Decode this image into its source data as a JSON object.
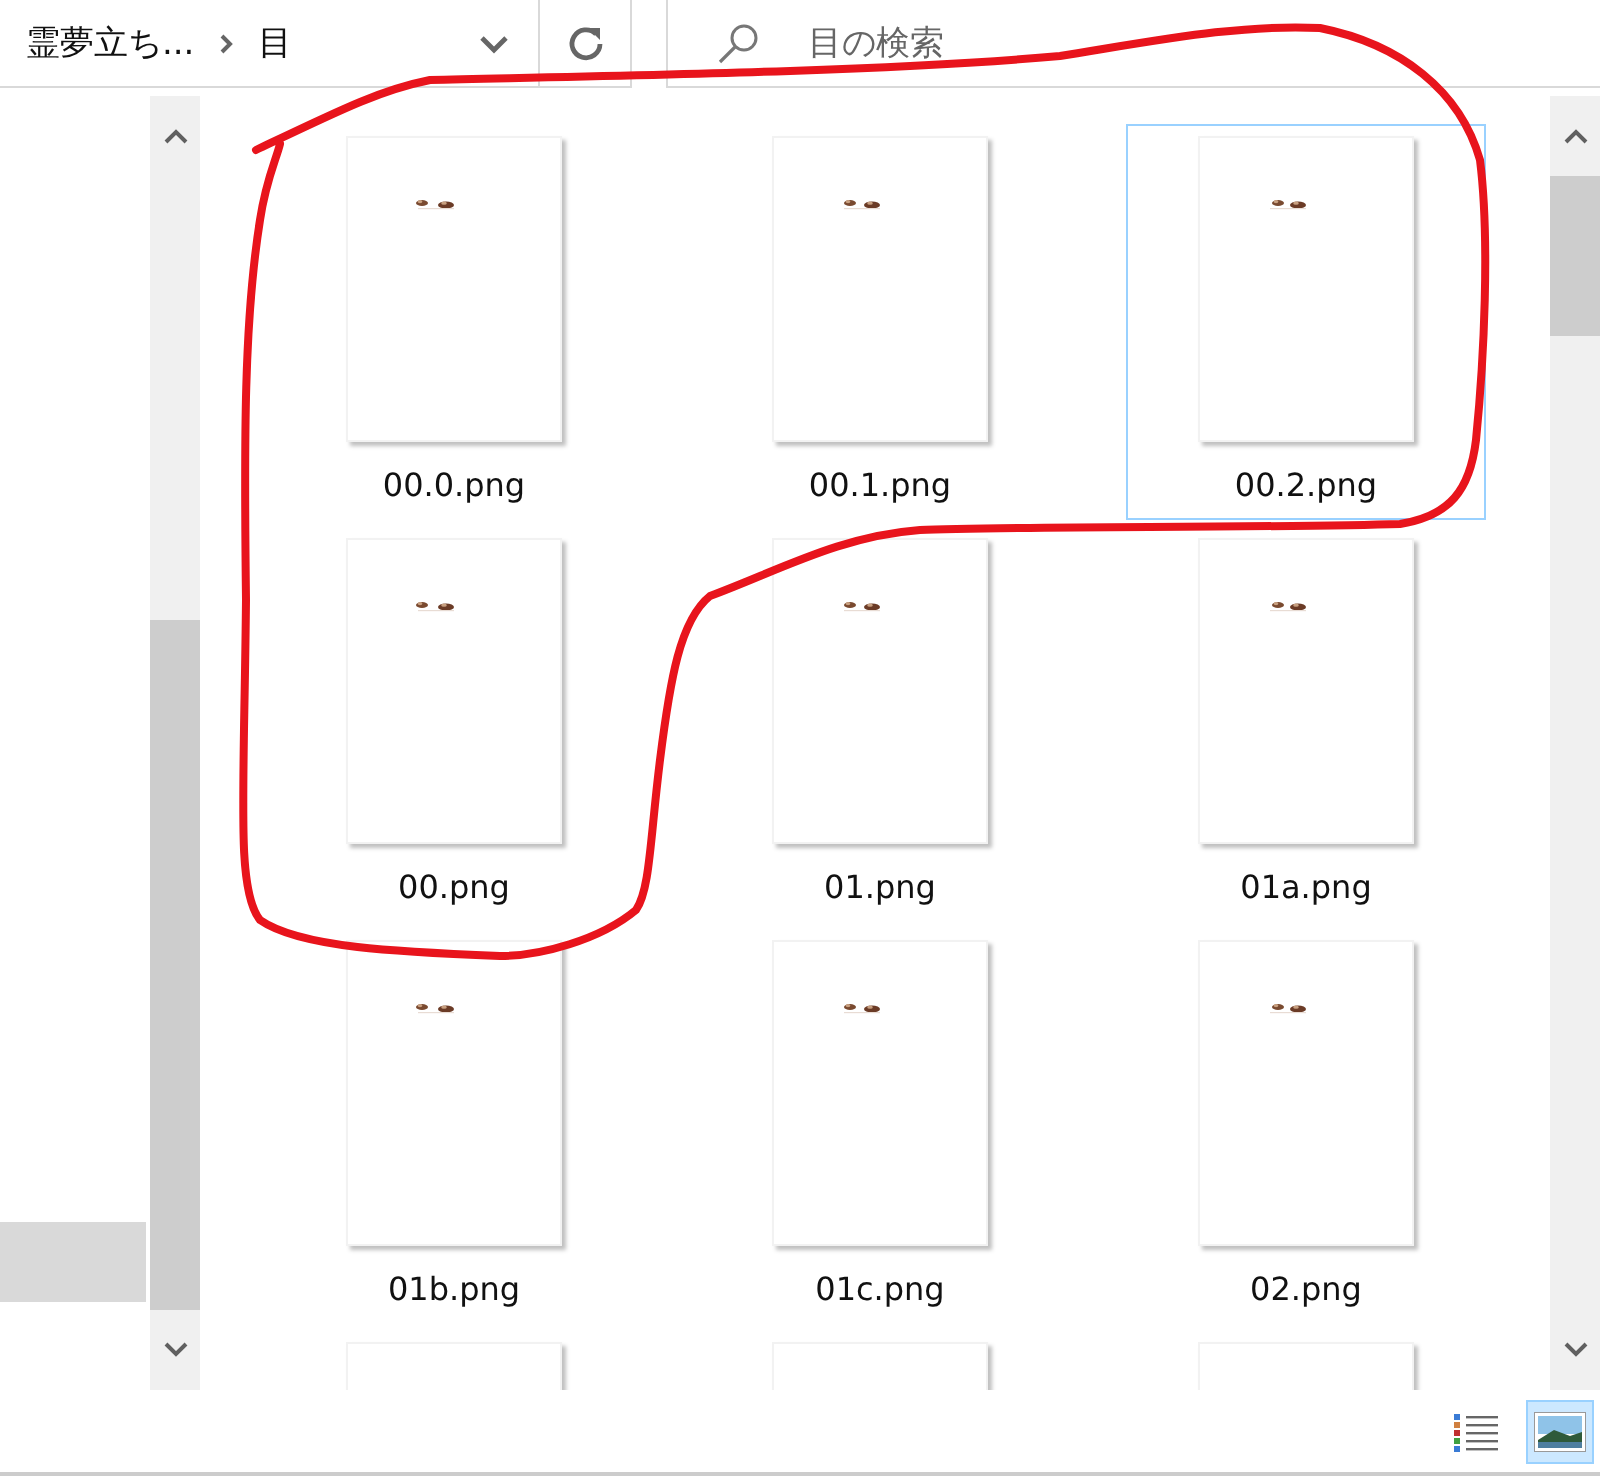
{
  "address_bar": {
    "path": [
      {
        "label": "霊夢立ち..."
      },
      {
        "label": "目"
      }
    ]
  },
  "search": {
    "placeholder": "目の検索"
  },
  "navigation_pane": {
    "rows": [
      {
        "selected": true
      }
    ]
  },
  "files": [
    {
      "kind": "file",
      "name": "00.0.png",
      "selected": false
    },
    {
      "kind": "file",
      "name": "00.1.png",
      "selected": false
    },
    {
      "kind": "file",
      "name": "00.2.png",
      "selected": true
    },
    {
      "kind": "file",
      "name": "00.png",
      "selected": false
    },
    {
      "kind": "file",
      "name": "01.png",
      "selected": false
    },
    {
      "kind": "file",
      "name": "01a.png",
      "selected": false
    },
    {
      "kind": "file",
      "name": "01b.png",
      "selected": false
    },
    {
      "kind": "file",
      "name": "01c.png",
      "selected": false
    },
    {
      "kind": "file",
      "name": "02.png",
      "selected": false
    },
    {
      "kind": "cut_off"
    },
    {
      "kind": "cut_off"
    },
    {
      "kind": "cut_off"
    }
  ],
  "view_buttons": [
    {
      "kind": "details",
      "selected": false
    },
    {
      "kind": "large_icons",
      "selected": true
    }
  ],
  "annotation": {
    "kind": "freehand_outline",
    "color": "#e8141c"
  }
}
